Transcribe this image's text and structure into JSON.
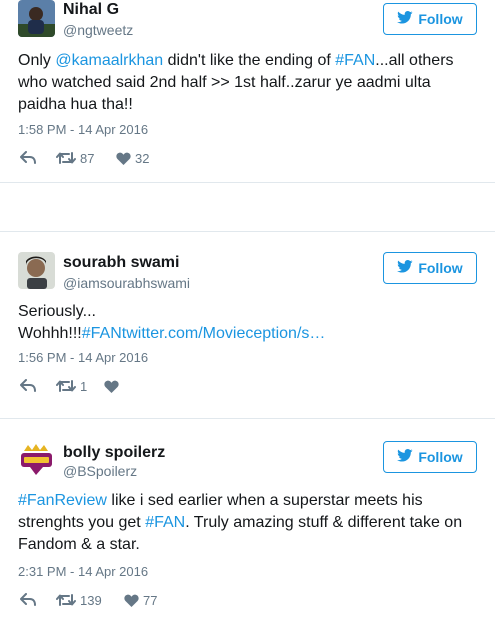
{
  "colors": {
    "accent": "#1b95e0",
    "muted": "#657786",
    "text": "#14171a",
    "divider": "#e1e8ed"
  },
  "follow_label": "Follow",
  "tweets": [
    {
      "user": {
        "name": "Nihal G",
        "handle": "@ngtweetz",
        "avatar": "person-photo-avatar"
      },
      "segments": [
        {
          "text": "Only ",
          "link": false
        },
        {
          "text": "@kamaalrkhan",
          "link": true
        },
        {
          "text": " didn't like the ending of ",
          "link": false
        },
        {
          "text": "#FAN",
          "link": true
        },
        {
          "text": "...all others who watched said 2nd half >> 1st half..zarur ye aadmi ulta paidha hua tha!!",
          "link": false
        }
      ],
      "time": "1:58 PM - 14 Apr 2016",
      "retweets": "87",
      "likes": "32"
    },
    {
      "user": {
        "name": "sourabh swami",
        "handle": "@iamsourabhswami",
        "avatar": "person-photo-avatar"
      },
      "segments": [
        {
          "text": "Seriously...",
          "link": false
        },
        {
          "text": "\n",
          "link": false
        },
        {
          "text": "Wohhh!!!",
          "link": false
        },
        {
          "text": "#FAN",
          "link": true
        },
        {
          "text": "twitter.com/Movieception/s…",
          "link": true
        }
      ],
      "time": "1:56 PM - 14 Apr 2016",
      "retweets": "1",
      "likes": ""
    },
    {
      "user": {
        "name": "bolly spoilerz",
        "handle": "@BSpoilerz",
        "avatar": "bollywood-logo-avatar"
      },
      "segments": [
        {
          "text": "#FanReview",
          "link": true
        },
        {
          "text": " like i sed earlier when a superstar meets his strenghts you get ",
          "link": false
        },
        {
          "text": "#FAN",
          "link": true
        },
        {
          "text": ". Truly amazing stuff & different take on Fandom & a star.",
          "link": false
        }
      ],
      "time": "2:31 PM - 14 Apr 2016",
      "retweets": "139",
      "likes": "77"
    }
  ]
}
